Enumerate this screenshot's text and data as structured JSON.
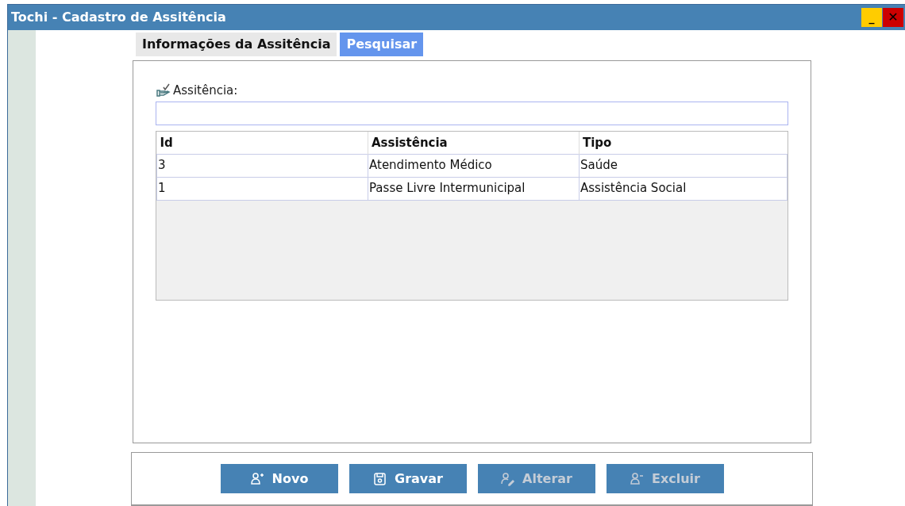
{
  "window": {
    "title": "Tochi - Cadastro de Assitência",
    "controls": [
      {
        "kind": "minimize",
        "label": "_"
      },
      {
        "kind": "close",
        "label": "✕"
      }
    ]
  },
  "tabs": [
    {
      "label": "Informações da Assitência",
      "selected": false
    },
    {
      "label": "Pesquisar",
      "selected": true
    }
  ],
  "search": {
    "label": "Assitência:"
  },
  "table": {
    "columns": [
      "Id",
      "Assistência",
      "Tipo"
    ],
    "rows": [
      [
        "3",
        "Atendimento Médico",
        "Saúde"
      ],
      [
        "1",
        "Passe Livre Intermunicipal",
        "Assistência Social"
      ]
    ]
  },
  "buttons": [
    {
      "label": "Novo",
      "kind": "add",
      "disabled": false
    },
    {
      "label": "Gravar",
      "kind": "save",
      "disabled": false
    },
    {
      "label": "Alterar",
      "kind": "edit",
      "disabled": true
    },
    {
      "label": "Excluir",
      "kind": "remove",
      "disabled": true
    }
  ]
}
